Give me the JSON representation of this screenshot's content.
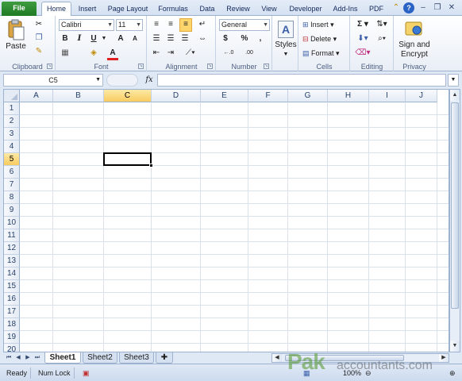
{
  "tabs": {
    "file": "File",
    "home": "Home",
    "insert": "Insert",
    "page_layout": "Page Layout",
    "formulas": "Formulas",
    "data": "Data",
    "review": "Review",
    "view": "View",
    "developer": "Developer",
    "add_ins": "Add-Ins",
    "pdf": "PDF"
  },
  "window_controls": {
    "minimize": "–",
    "restore": "❐",
    "close": "✕",
    "help": "?"
  },
  "ribbon": {
    "clipboard": {
      "label": "Clipboard",
      "paste": "Paste"
    },
    "font": {
      "label": "Font",
      "name": "Calibri",
      "size": "11",
      "bold": "B",
      "italic": "I",
      "underline": "U",
      "grow": "A",
      "shrink": "A",
      "font_color": "A"
    },
    "alignment": {
      "label": "Alignment"
    },
    "number": {
      "label": "Number",
      "format": "General",
      "currency": "$",
      "percent": "%",
      "comma": ",",
      "inc_decimal": "←.0",
      "dec_decimal": ".00"
    },
    "styles": {
      "label": "Styles"
    },
    "cells": {
      "label": "Cells",
      "insert": "Insert",
      "delete": "Delete",
      "format": "Format"
    },
    "editing": {
      "label": "Editing",
      "sum": "Σ"
    },
    "privacy": {
      "label": "Privacy",
      "sign": "Sign and",
      "encrypt": "Encrypt"
    }
  },
  "formula_bar": {
    "name_box": "C5",
    "fx": "fx",
    "value": ""
  },
  "grid": {
    "columns": [
      "A",
      "B",
      "C",
      "D",
      "E",
      "F",
      "G",
      "H",
      "I",
      "J"
    ],
    "rows": [
      "1",
      "2",
      "3",
      "4",
      "5",
      "6",
      "7",
      "8",
      "9",
      "10",
      "11",
      "12",
      "13",
      "14",
      "15",
      "16",
      "17",
      "18",
      "19",
      "20"
    ],
    "selected_column": "C",
    "selected_row": "5"
  },
  "sheets": [
    "Sheet1",
    "Sheet2",
    "Sheet3"
  ],
  "active_sheet": "Sheet1",
  "status": {
    "ready": "Ready",
    "num_lock": "Num Lock",
    "zoom": "100%"
  },
  "watermark": {
    "brand": "Pak",
    "suffix": "accountants.com"
  }
}
